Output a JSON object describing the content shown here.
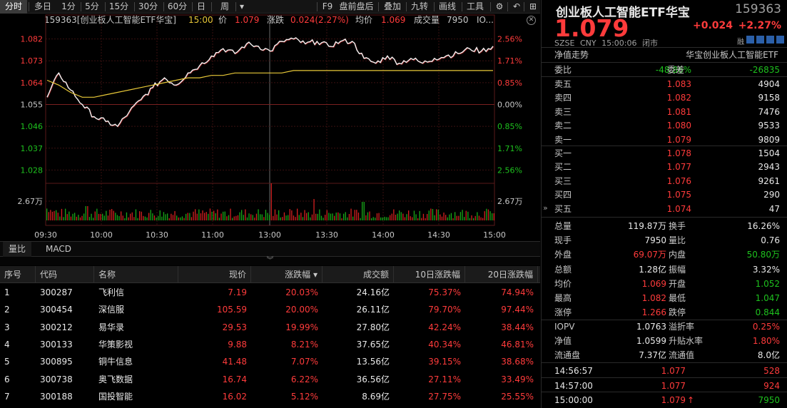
{
  "toolbar": {
    "items": [
      "分时",
      "多日",
      "1分",
      "5分",
      "15分",
      "30分",
      "60分",
      "日",
      "周",
      "▾",
      "F9",
      "盘前盘后",
      "叠加",
      "九转",
      "画线",
      "工具",
      "⚙",
      "↶",
      "⊞"
    ]
  },
  "infobar": {
    "name": "159363[创业板人工智能ETF华宝]",
    "time": "15:00",
    "price_label": "价",
    "price": "1.079",
    "chg_label": "涨跌",
    "chg": "0.024(2.27%)",
    "avg_label": "均价",
    "avg": "1.069",
    "vol_label": "成交量",
    "vol": "7950",
    "more": "IO..."
  },
  "chart": {
    "price_ticks": [
      "1.082",
      "1.073",
      "1.064",
      "1.055",
      "1.046",
      "1.037",
      "1.028"
    ],
    "pct_ticks": [
      "2.56%",
      "1.71%",
      "0.85%",
      "0.00%",
      "0.85%",
      "1.71%",
      "2.56%"
    ],
    "vol_tick_left": "2.67万",
    "vol_tick_right": "2.67万",
    "time_ticks": [
      "09:30",
      "10:00",
      "10:30",
      "11:00",
      "13:00",
      "13:30",
      "14:00",
      "14:30",
      "15:00"
    ]
  },
  "chart_data": {
    "type": "line",
    "x": [
      "09:30",
      "10:00",
      "10:30",
      "11:00",
      "13:00",
      "13:30",
      "14:00",
      "14:30",
      "15:00"
    ],
    "ylim": [
      1.024,
      1.086
    ],
    "prev_close": 1.055,
    "series": [],
    "price_points": [
      1.058,
      1.068,
      1.061,
      1.055,
      1.05,
      1.048,
      1.046,
      1.052,
      1.057,
      1.062,
      1.066,
      1.063,
      1.068,
      1.071,
      1.075,
      1.078,
      1.076,
      1.08,
      1.079,
      1.077,
      1.081,
      1.082,
      1.08,
      1.081,
      1.079,
      1.081,
      1.081,
      1.074,
      1.072,
      1.075,
      1.072,
      1.074,
      1.072,
      1.074,
      1.075,
      1.076,
      1.078,
      1.077,
      1.079
    ],
    "avg_points": [
      1.065,
      1.063,
      1.06,
      1.058,
      1.058,
      1.059,
      1.06,
      1.061,
      1.062,
      1.063,
      1.064,
      1.065,
      1.066,
      1.066,
      1.067,
      1.067,
      1.068,
      1.068,
      1.068,
      1.068,
      1.068,
      1.069,
      1.069,
      1.069,
      1.069,
      1.069,
      1.069,
      1.069,
      1.069,
      1.069,
      1.069,
      1.069,
      1.069,
      1.069,
      1.069,
      1.069,
      1.069,
      1.069,
      1.069
    ]
  },
  "indicator_tabs": [
    "量比",
    "MACD"
  ],
  "collapse_icon": "double-chevron-down",
  "table": {
    "headers": [
      "序号",
      "代码",
      "名称",
      "现价",
      "涨跌幅 ▾",
      "成交额",
      "10日涨跌幅",
      "20日涨跌幅"
    ],
    "rows": [
      [
        "1",
        "300287",
        "飞利信",
        "7.19",
        "20.03%",
        "24.16亿",
        "75.37%",
        "74.94%"
      ],
      [
        "2",
        "300454",
        "深信服",
        "105.59",
        "20.00%",
        "26.11亿",
        "79.70%",
        "97.44%"
      ],
      [
        "3",
        "300212",
        "易华录",
        "29.53",
        "19.99%",
        "27.80亿",
        "42.24%",
        "38.44%"
      ],
      [
        "4",
        "300133",
        "华策影视",
        "9.88",
        "8.21%",
        "37.65亿",
        "40.34%",
        "46.81%"
      ],
      [
        "5",
        "300895",
        "铜牛信息",
        "41.48",
        "7.07%",
        "13.56亿",
        "39.15%",
        "38.68%"
      ],
      [
        "6",
        "300738",
        "奥飞数据",
        "16.74",
        "6.22%",
        "36.56亿",
        "27.11%",
        "33.49%"
      ],
      [
        "7",
        "300188",
        "国投智能",
        "16.02",
        "5.12%",
        "8.69亿",
        "27.75%",
        "25.55%"
      ]
    ]
  },
  "quote": {
    "name": "创业板人工智能ETF华宝",
    "code": "159363",
    "price": "1.079",
    "change": "+0.024",
    "change_pct": "+2.27%",
    "meta": [
      "SZSE",
      "CNY",
      "15:00:06",
      "闭市"
    ],
    "nav_label": "净值走势",
    "fund_name": "华宝创业板人工智能ETF",
    "weibi_label": "委比",
    "weibi": "-48.86%",
    "weicha_label": "委差",
    "weicha": "-26835",
    "sell": [
      {
        "label": "卖五",
        "price": "1.083",
        "vol": "4904"
      },
      {
        "label": "卖四",
        "price": "1.082",
        "vol": "9158"
      },
      {
        "label": "卖三",
        "price": "1.081",
        "vol": "7476"
      },
      {
        "label": "卖二",
        "price": "1.080",
        "vol": "9533"
      },
      {
        "label": "卖一",
        "price": "1.079",
        "vol": "9809"
      }
    ],
    "buy": [
      {
        "label": "买一",
        "price": "1.078",
        "vol": "1504"
      },
      {
        "label": "买二",
        "price": "1.077",
        "vol": "2943"
      },
      {
        "label": "买三",
        "price": "1.076",
        "vol": "9261"
      },
      {
        "label": "买四",
        "price": "1.075",
        "vol": "290"
      },
      {
        "label": "买五",
        "price": "1.074",
        "vol": "47"
      }
    ],
    "stats": [
      {
        "l1": "总量",
        "v1": "119.87万",
        "c1": "white",
        "l2": "换手",
        "v2": "16.26%",
        "c2": "white"
      },
      {
        "l1": "现手",
        "v1": "7950",
        "c1": "white",
        "l2": "量比",
        "v2": "0.76",
        "c2": "white"
      },
      {
        "l1": "外盘",
        "v1": "69.07万",
        "c1": "red",
        "l2": "内盘",
        "v2": "50.80万",
        "c2": "green"
      },
      {
        "l1": "总额",
        "v1": "1.28亿",
        "c1": "white",
        "l2": "振幅",
        "v2": "3.32%",
        "c2": "white"
      },
      {
        "l1": "均价",
        "v1": "1.069",
        "c1": "red",
        "l2": "开盘",
        "v2": "1.052",
        "c2": "green"
      },
      {
        "l1": "最高",
        "v1": "1.082",
        "c1": "red",
        "l2": "最低",
        "v2": "1.047",
        "c2": "green"
      },
      {
        "l1": "涨停",
        "v1": "1.266",
        "c1": "red",
        "l2": "跌停",
        "v2": "0.844",
        "c2": "green"
      }
    ],
    "fund_stats": [
      {
        "l1": "IOPV",
        "v1": "1.0763",
        "c1": "white",
        "l2": "溢折率",
        "v2": "0.25%",
        "c2": "red"
      },
      {
        "l1": "净值",
        "v1": "1.0599",
        "c1": "white",
        "l2": "升贴水率",
        "v2": "1.80%",
        "c2": "red"
      },
      {
        "l1": "流通盘",
        "v1": "7.37亿",
        "c1": "white",
        "l2": "流通值",
        "v2": "8.0亿",
        "c2": "white"
      }
    ],
    "ticks": [
      {
        "time": "14:56:57",
        "price": "1.077",
        "vol": "528",
        "arrow": ""
      },
      {
        "time": "14:57:00",
        "price": "1.077",
        "vol": "924",
        "arrow": ""
      },
      {
        "time": "15:00:00",
        "price": "1.079",
        "vol": "7950",
        "arrow": "↑"
      }
    ],
    "side_tab": "买五"
  }
}
